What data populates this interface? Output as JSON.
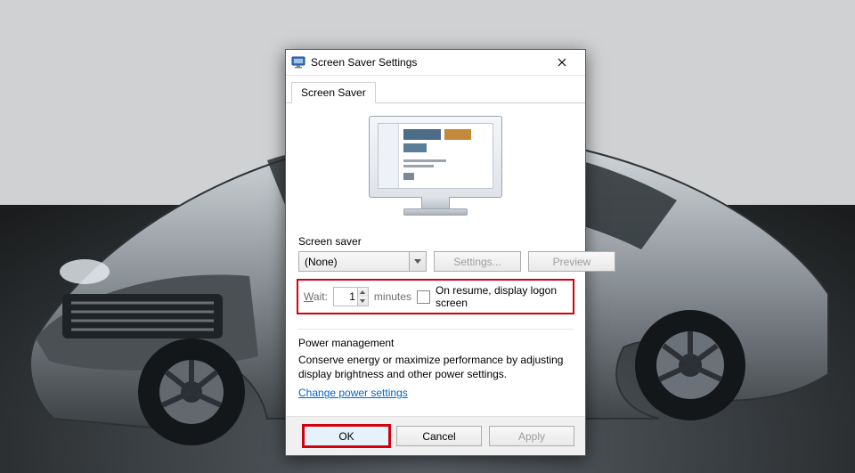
{
  "window": {
    "title": "Screen Saver Settings"
  },
  "tab": {
    "label": "Screen Saver"
  },
  "screensaver": {
    "group_label": "Screen saver",
    "selected": "(None)",
    "settings_btn": "Settings...",
    "preview_btn": "Preview"
  },
  "wait": {
    "label": "Wait:",
    "value": "1",
    "units": "minutes",
    "checkbox_label": "On resume, display logon screen",
    "checked": false
  },
  "power": {
    "group_label": "Power management",
    "text": "Conserve energy or maximize performance by adjusting display brightness and other power settings.",
    "link": "Change power settings"
  },
  "buttons": {
    "ok": "OK",
    "cancel": "Cancel",
    "apply": "Apply"
  }
}
